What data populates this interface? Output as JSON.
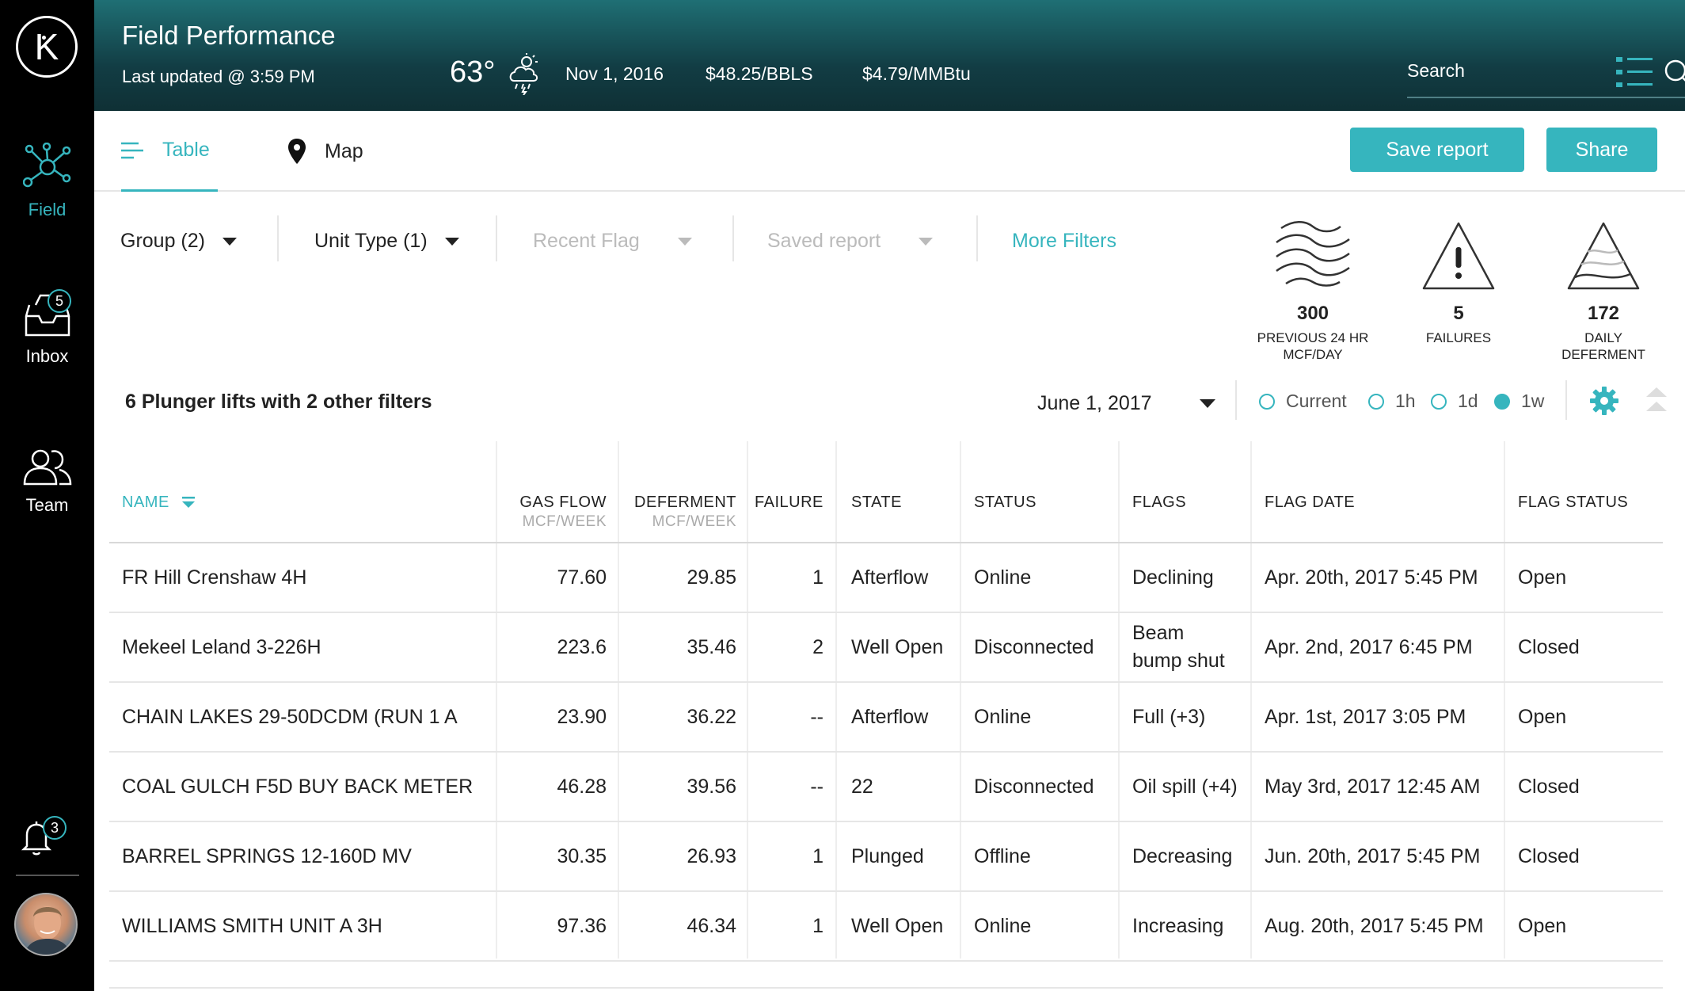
{
  "sidebar": {
    "logo": "K",
    "items": [
      {
        "label": "Field"
      },
      {
        "label": "Inbox",
        "badge": "5"
      },
      {
        "label": "Team"
      }
    ],
    "notifications_badge": "3"
  },
  "header": {
    "title": "Field Performance",
    "last_updated": "Last updated @ 3:59 PM",
    "temperature": "63°",
    "date": "Nov 1, 2016",
    "oil_price": "$48.25/BBLS",
    "gas_price": "$4.79/MMBtu",
    "search_placeholder": "Search"
  },
  "tabs": [
    {
      "label": "Table",
      "active": true
    },
    {
      "label": "Map",
      "active": false
    }
  ],
  "actions": {
    "save_label": "Save report",
    "share_label": "Share"
  },
  "filters": {
    "group": "Group (2)",
    "unit_type": "Unit Type (1)",
    "recent_flag": "Recent Flag",
    "saved_report": "Saved report",
    "more": "More Filters"
  },
  "kpis": [
    {
      "value": "300",
      "label_line1": "PREVIOUS 24 HR",
      "label_line2": "MCF/DAY"
    },
    {
      "value": "5",
      "label_line1": "FAILURES",
      "label_line2": ""
    },
    {
      "value": "172",
      "label_line1": "DAILY",
      "label_line2": "DEFERMENT"
    }
  ],
  "summary": "6 Plunger lifts with 2 other filters",
  "date_select": "June 1, 2017",
  "time_ranges": [
    {
      "label": "Current",
      "checked": false
    },
    {
      "label": "1h",
      "checked": false
    },
    {
      "label": "1d",
      "checked": false
    },
    {
      "label": "1w",
      "checked": true
    }
  ],
  "table": {
    "headers": {
      "name": "NAME",
      "gas_flow": "GAS FLOW",
      "gas_flow_unit": "MCF/WEEK",
      "deferment": "DEFERMENT",
      "deferment_unit": "MCF/WEEK",
      "failure": "FAILURE",
      "state": "STATE",
      "status": "STATUS",
      "flags": "FLAGS",
      "flag_date": "FLAG DATE",
      "flag_status": "FLAG STATUS"
    },
    "rows": [
      {
        "name": "FR Hill Crenshaw 4H",
        "gas_flow": "77.60",
        "deferment": "29.85",
        "failure": "1",
        "state": "Afterflow",
        "status": "Online",
        "flags": "Declining",
        "flags2": "",
        "flag_date": "Apr. 20th, 2017 5:45 PM",
        "flag_status": "Open"
      },
      {
        "name": "Mekeel Leland 3-226H",
        "gas_flow": "223.6",
        "deferment": "35.46",
        "failure": "2",
        "state": "Well Open",
        "status": "Disconnected",
        "flags": "Beam",
        "flags2": "bump shut",
        "flag_date": "Apr. 2nd, 2017 6:45 PM",
        "flag_status": "Closed"
      },
      {
        "name": "CHAIN LAKES 29-50DCDM (RUN 1 A",
        "gas_flow": "23.90",
        "deferment": "36.22",
        "failure": "--",
        "state": "Afterflow",
        "status": "Online",
        "flags": "Full (+3)",
        "flags2": "",
        "flag_date": "Apr. 1st, 2017 3:05 PM",
        "flag_status": "Open"
      },
      {
        "name": "COAL GULCH F5D BUY BACK METER",
        "gas_flow": "46.28",
        "deferment": "39.56",
        "failure": "--",
        "state": "22",
        "status": "Disconnected",
        "flags": "Oil spill (+4)",
        "flags2": "",
        "flag_date": "May 3rd, 2017 12:45 AM",
        "flag_status": "Closed"
      },
      {
        "name": "BARREL SPRINGS 12-160D MV",
        "gas_flow": "30.35",
        "deferment": "26.93",
        "failure": "1",
        "state": "Plunged",
        "status": "Offline",
        "flags": "Decreasing",
        "flags2": "",
        "flag_date": "Jun. 20th, 2017 5:45 PM",
        "flag_status": "Closed"
      },
      {
        "name": "WILLIAMS SMITH UNIT A 3H",
        "gas_flow": "97.36",
        "deferment": "46.34",
        "failure": "1",
        "state": "Well Open",
        "status": "Online",
        "flags": "Increasing",
        "flags2": "",
        "flag_date": "Aug. 20th, 2017 5:45 PM",
        "flag_status": "Open"
      }
    ]
  },
  "colors": {
    "accent": "#36b5be",
    "header_dark": "#123d44",
    "sidebar": "#000000"
  }
}
